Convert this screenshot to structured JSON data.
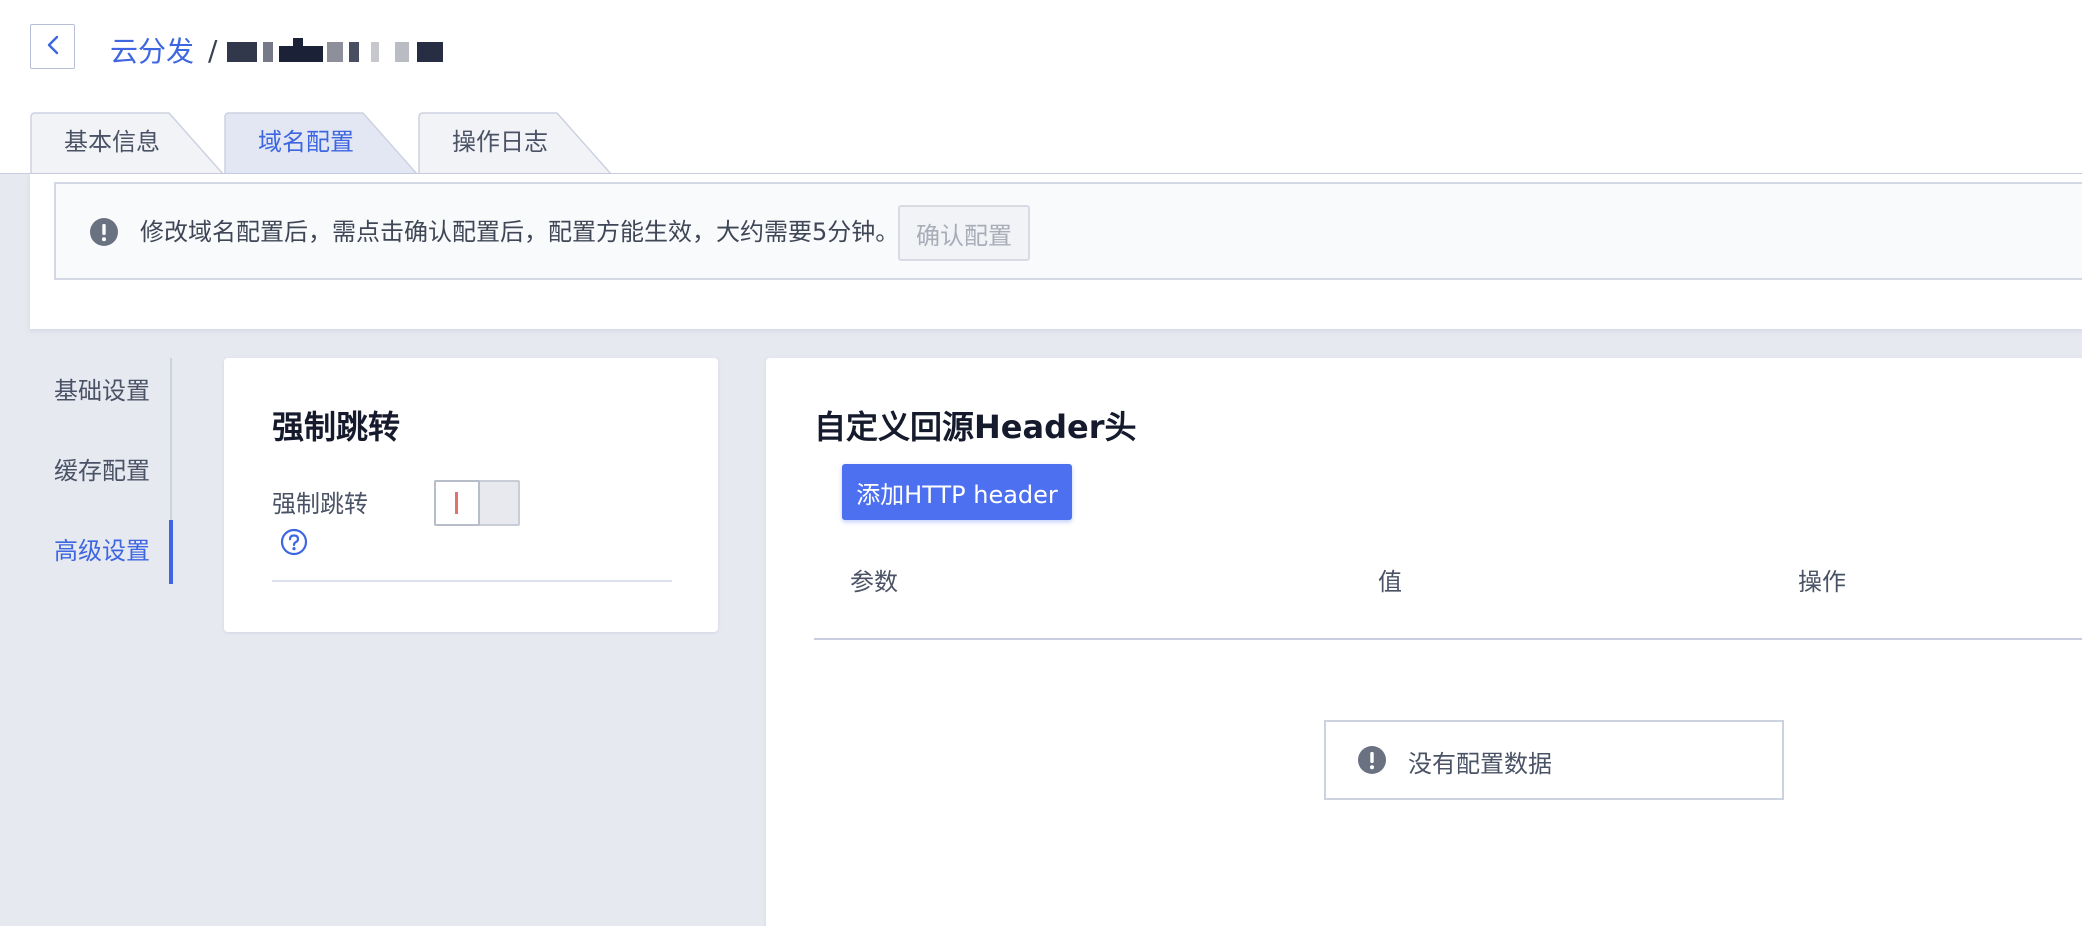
{
  "header": {
    "back_icon": "chevron-left-icon",
    "breadcrumb": {
      "root": "云分发",
      "separator": "/",
      "current": "(redacted)"
    }
  },
  "tabs": [
    {
      "label": "基本信息",
      "active": false
    },
    {
      "label": "域名配置",
      "active": true
    },
    {
      "label": "操作日志",
      "active": false
    }
  ],
  "notice": {
    "icon": "exclamation-circle-icon",
    "text": "修改域名配置后，需点击确认配置后，配置方能生效，大约需要5分钟。",
    "confirm_label": "确认配置",
    "confirm_disabled": true
  },
  "side_nav": {
    "items": [
      {
        "label": "基础设置",
        "active": false
      },
      {
        "label": "缓存配置",
        "active": false
      },
      {
        "label": "高级设置",
        "active": true
      }
    ]
  },
  "redirect_card": {
    "title": "强制跳转",
    "field_label": "强制跳转",
    "help_icon": "question-circle-icon",
    "toggle_on": false
  },
  "header_card": {
    "title": "自定义回源Header头",
    "add_label": "添加HTTP header",
    "columns": [
      "参数",
      "值",
      "操作"
    ],
    "rows": [],
    "empty_icon": "exclamation-circle-icon",
    "empty_text": "没有配置数据"
  },
  "colors": {
    "accent": "#3d66e0",
    "primary_button": "#4d70f0",
    "page_bg": "#e7e9f1",
    "text": "#4a5265"
  }
}
